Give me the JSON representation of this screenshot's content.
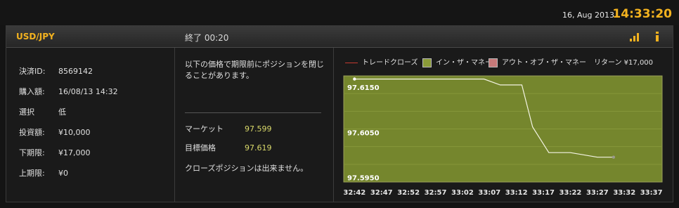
{
  "header": {
    "date": "16, Aug 2013",
    "time": "14:33:20"
  },
  "panel": {
    "pair": "USD/JPY",
    "status": "終了 00:20",
    "icons": {
      "signal": "signal-bars-icon",
      "info": "info-icon"
    },
    "colors": {
      "accent": "#f3b21f",
      "value": "#d9d96a"
    }
  },
  "details": [
    {
      "label": "決済ID:",
      "value": "8569142"
    },
    {
      "label": "購入額:",
      "value": "16/08/13 14:32"
    },
    {
      "label": "選択",
      "value": "低"
    },
    {
      "label": "投資額:",
      "value": "¥10,000"
    },
    {
      "label": "下期限:",
      "value": "¥17,000"
    },
    {
      "label": "上期限:",
      "value": "¥0"
    }
  ],
  "middle": {
    "note": "以下の価格で期限前にポジションを閉じることがあります。",
    "market_label": "マーケット",
    "market_value": "97.599",
    "target_label": "目標価格",
    "target_value": "97.619",
    "footer": "クローズポジションは出来ません。"
  },
  "legend": {
    "close": "トレードクローズ",
    "itm": "イン・ザ・マネー",
    "otm": "アウト・オブ・ザ・マネー",
    "return": "リターン ¥17,000",
    "colors": {
      "close": "#c43a30",
      "itm": "#8a9a38",
      "otm": "#c77a7a"
    }
  },
  "chart_data": {
    "type": "line",
    "x_ticks": [
      "32:42",
      "32:47",
      "32:52",
      "32:57",
      "33:02",
      "33:07",
      "33:12",
      "33:17",
      "33:22",
      "33:27",
      "33:32",
      "33:37"
    ],
    "y_ticks": [
      "97.6150",
      "97.6050",
      "97.5950"
    ],
    "ylim": [
      97.594,
      97.6175
    ],
    "xlim": [
      -2,
      57
    ],
    "background": "#75862d",
    "series": [
      {
        "x": [
          0,
          24,
          27,
          31,
          33,
          36,
          40,
          45,
          48
        ],
        "y": [
          97.6168,
          97.6168,
          97.6155,
          97.6155,
          97.6062,
          97.6005,
          97.6005,
          97.5995,
          97.5995
        ]
      }
    ]
  }
}
